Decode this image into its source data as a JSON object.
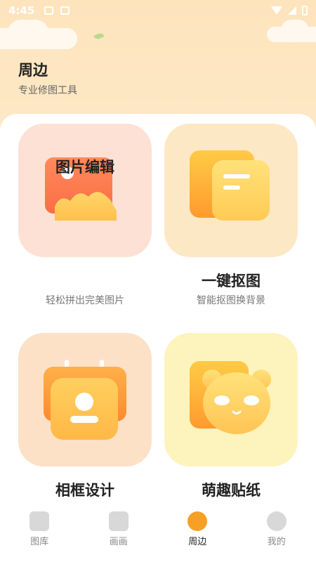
{
  "status_bar": {
    "time": "4:45"
  },
  "header": {
    "title": "周边",
    "subtitle": "专业修图工具"
  },
  "cards": [
    {
      "title": "图片编辑",
      "subtitle": "轻松拼出完美图片"
    },
    {
      "title": "一键抠图",
      "subtitle": "智能抠图换背景"
    },
    {
      "title": "相框设计",
      "subtitle": ""
    },
    {
      "title": "萌趣贴纸",
      "subtitle": ""
    }
  ],
  "tabs": [
    {
      "label": "图库",
      "icon": "gallery-icon"
    },
    {
      "label": "画画",
      "icon": "draw-icon"
    },
    {
      "label": "周边",
      "icon": "palette-icon"
    },
    {
      "label": "我的",
      "icon": "profile-icon"
    }
  ]
}
